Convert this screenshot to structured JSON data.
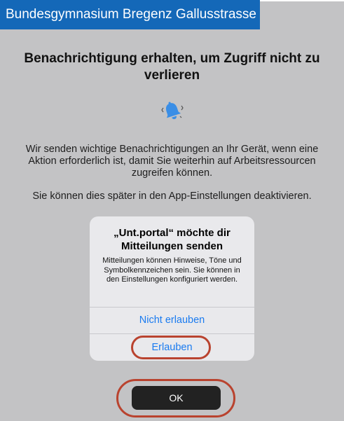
{
  "header": {
    "title": "Bundesgymnasium Bregenz Gallusstrasse"
  },
  "main": {
    "heading": "Benachrichtigung erhalten, um Zugriff nicht zu verlieren",
    "icon": "bell-ringing-icon",
    "description": "Wir senden wichtige Benachrichtigungen an Ihr Gerät, wenn eine Aktion erforderlich ist, damit Sie weiterhin auf Arbeitsressourcen zugreifen können.",
    "note": "Sie können dies später in den App-Einstellungen deaktivieren.",
    "ok_label": "OK"
  },
  "alert": {
    "title": "„Unt.portal“ möchte dir Mitteilungen senden",
    "message": "Mitteilungen können Hinweise, Töne und Symbolkennzeichen sein. Sie können in den Einstellungen konfiguriert werden.",
    "deny_label": "Nicht erlauben",
    "allow_label": "Erlauben"
  },
  "colors": {
    "header_bg": "#1468b8",
    "accent_link": "#1a7bf0",
    "highlight_ring": "#b9432f",
    "bell": "#3a8ee6"
  }
}
